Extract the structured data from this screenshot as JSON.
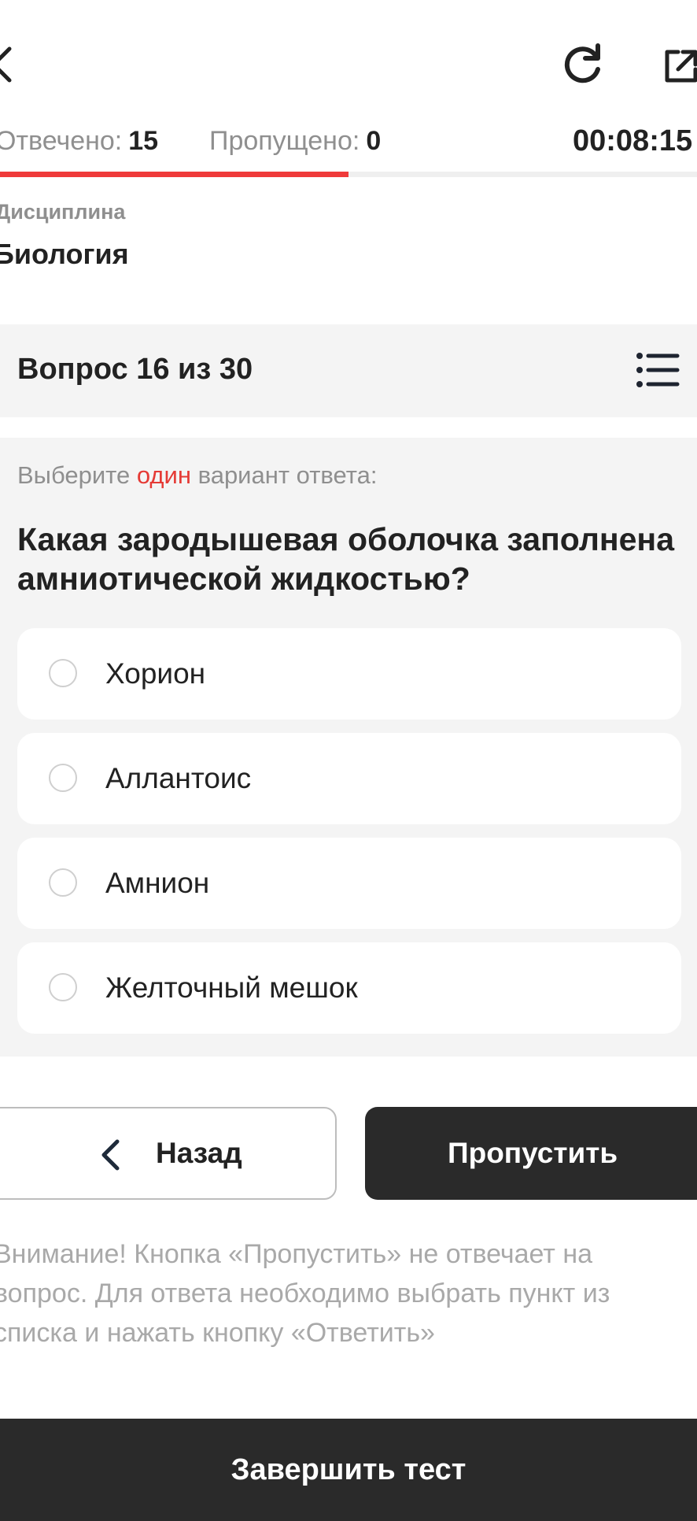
{
  "stats": {
    "answered_label": "Отвечено:",
    "answered_value": "15",
    "skipped_label": "Пропущено:",
    "skipped_value": "0",
    "timer": "00:08:15"
  },
  "progress": {
    "fraction": 0.5,
    "color": "#ef3a3a"
  },
  "discipline": {
    "label": "Дисциплина",
    "value": "Биология"
  },
  "question_counter": "Вопрос 16 из 30",
  "question": {
    "instruction_before": "Выберите ",
    "instruction_accent": "один",
    "instruction_after": " вариант ответа:",
    "text": "Какая зародышевая оболочка заполнена амниотической жидкостью?",
    "options": [
      "Хорион",
      "Аллантоис",
      "Амнион",
      "Желточный мешок"
    ]
  },
  "buttons": {
    "back": "Назад",
    "skip": "Пропустить",
    "finish": "Завершить тест"
  },
  "warning": "Внимание! Кнопка «Пропустить» не отвечает на вопрос. Для ответа необходимо выбрать пункт из списка и нажать кнопку «Ответить»",
  "icons": {
    "back": "chevron-left-icon",
    "refresh": "refresh-icon",
    "share": "external-link-icon",
    "list": "list-icon"
  },
  "colors": {
    "accent": "#e53a35",
    "dark_button": "#2a2a2a"
  }
}
